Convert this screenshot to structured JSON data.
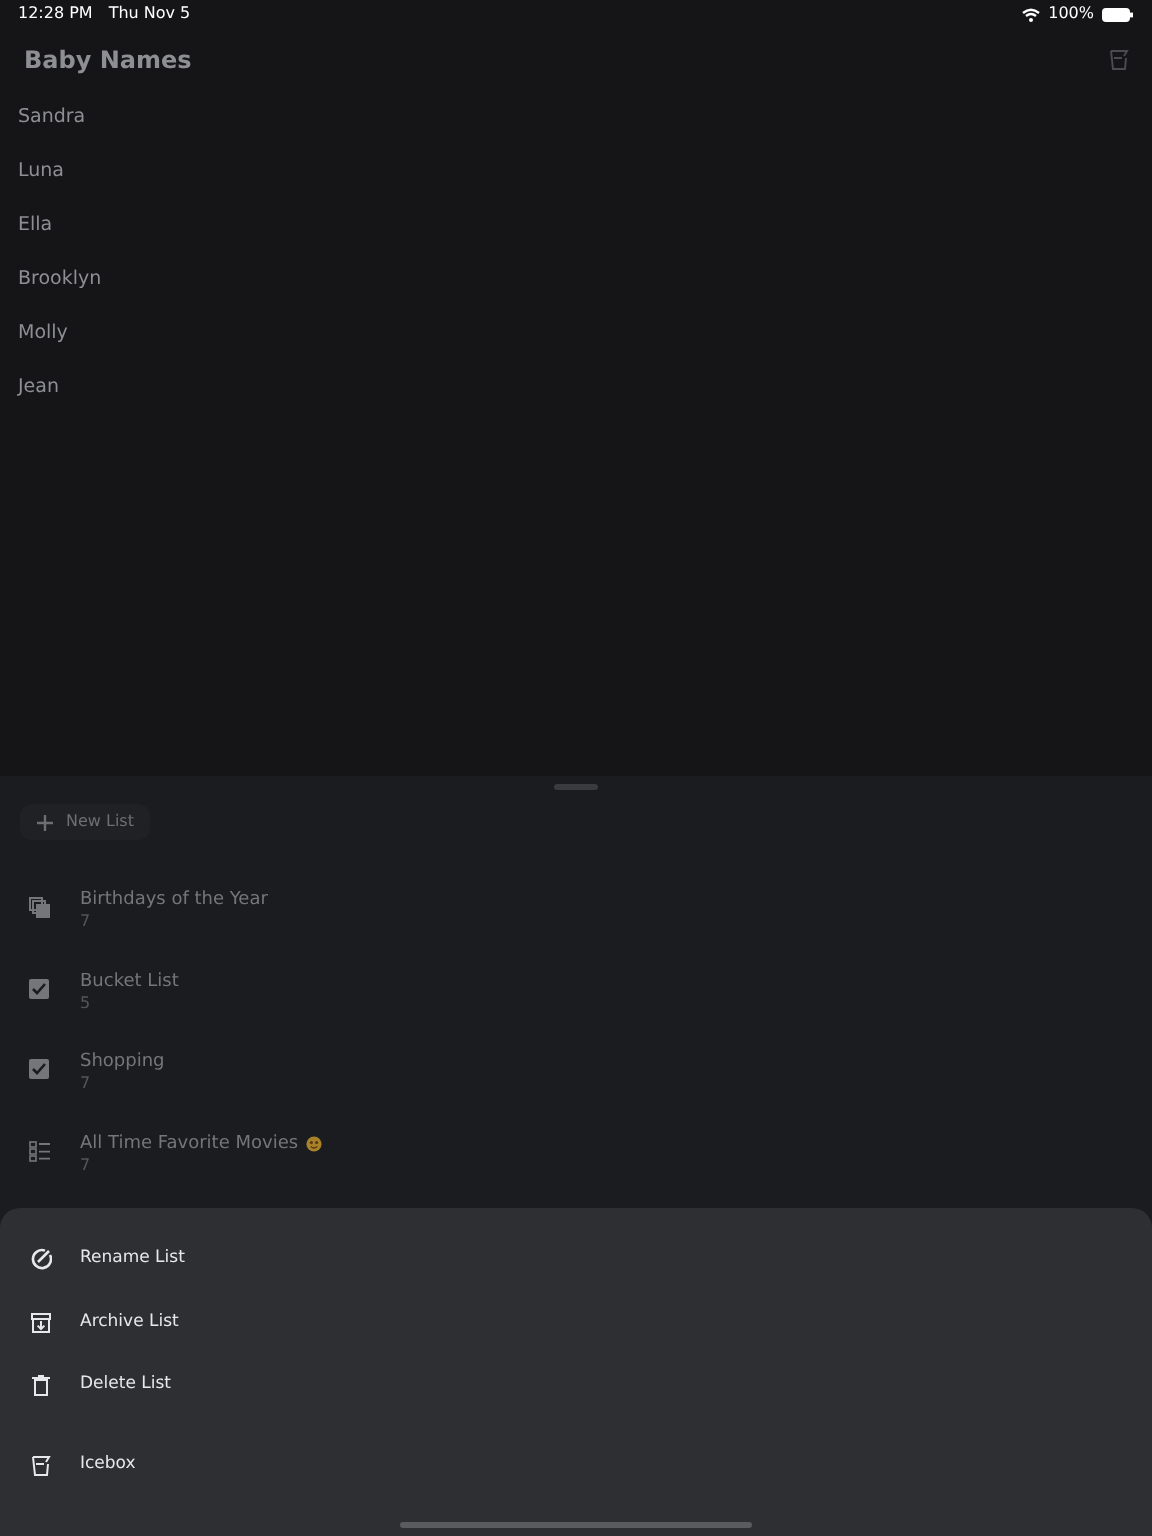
{
  "status_bar": {
    "time": "12:28 PM",
    "date": "Thu Nov 5",
    "battery": "100%"
  },
  "header": {
    "title": "Baby Names"
  },
  "names": [
    "Sandra",
    "Luna",
    "Ella",
    "Brooklyn",
    "Molly",
    "Jean"
  ],
  "new_list_button": {
    "label": "New List"
  },
  "lists": [
    {
      "kind": "stack",
      "title": "Birthdays of the Year",
      "count": "7"
    },
    {
      "kind": "checkbox",
      "title": "Bucket List",
      "count": "5"
    },
    {
      "kind": "checkbox",
      "title": "Shopping",
      "count": "7"
    },
    {
      "kind": "checklist",
      "title": "All Time Favorite Movies",
      "emoji": true,
      "count": "7"
    }
  ],
  "action_sheet": {
    "items": [
      {
        "kind": "rename",
        "label": "Rename List"
      },
      {
        "kind": "archive",
        "label": "Archive List"
      },
      {
        "kind": "delete",
        "label": "Delete List"
      },
      {
        "kind": "icebox",
        "label": "Icebox",
        "separated": true
      }
    ]
  }
}
